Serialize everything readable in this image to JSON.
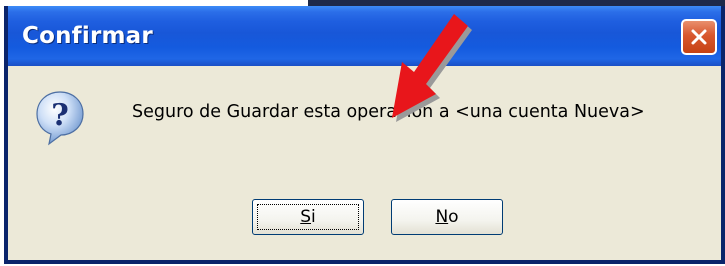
{
  "dialog": {
    "title": "Confirmar",
    "message": "Seguro de Guardar esta operación a <una cuenta Nueva>",
    "icon": "question-icon",
    "buttons": {
      "yes_mnemonic": "S",
      "yes_rest": "i",
      "no_mnemonic": "N",
      "no_rest": "o"
    }
  },
  "colors": {
    "titlebar": "#1f5fe0",
    "face": "#ece9d8",
    "close": "#d8572e",
    "annotation_arrow": "#e8161b"
  }
}
